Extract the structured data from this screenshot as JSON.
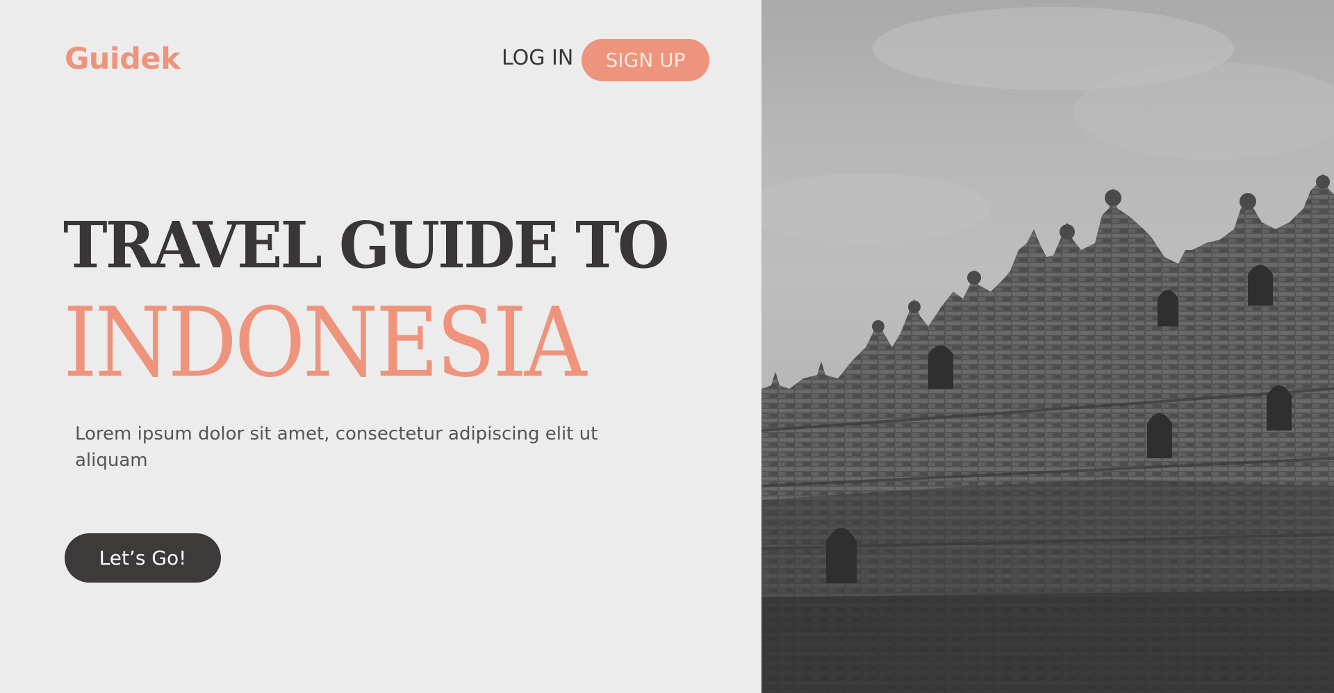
{
  "brand": {
    "name": "Guidek",
    "color": "#ef947c"
  },
  "nav": {
    "login_label": "LOG IN",
    "signup_label": "SIGN UP"
  },
  "hero": {
    "headline_line1": "TRAVEL GUIDE TO",
    "headline_line2": "INDONESIA",
    "description": "Lorem ipsum dolor sit amet, consectetur adipiscing elit ut aliquam",
    "cta_label": "Let’s Go!"
  },
  "colors": {
    "accent": "#ef947c",
    "dark": "#3e3a39",
    "background": "#ececec"
  },
  "image": {
    "subject": "temple-photo"
  }
}
